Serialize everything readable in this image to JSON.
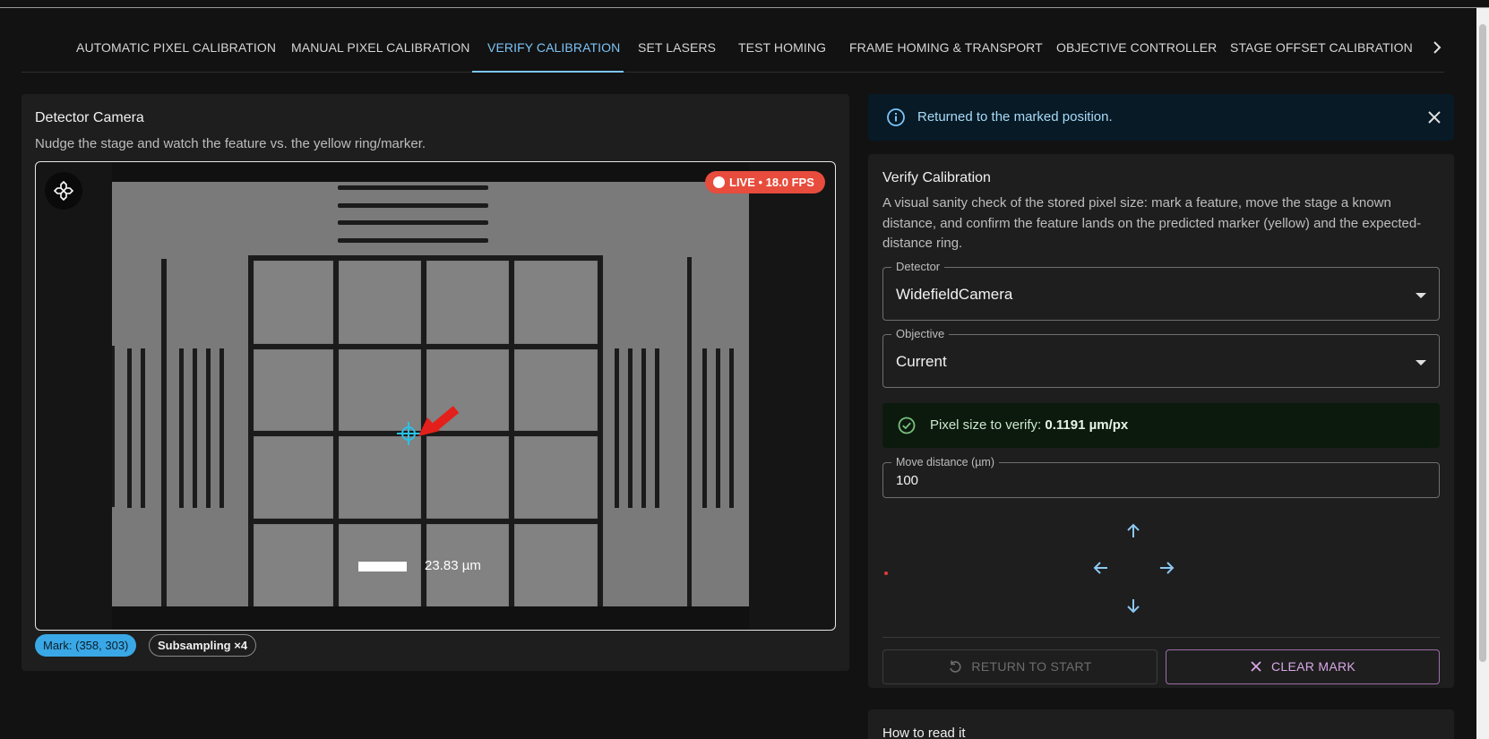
{
  "tabs": {
    "items": [
      {
        "label": "AUTOMATIC PIXEL CALIBRATION"
      },
      {
        "label": "MANUAL PIXEL CALIBRATION"
      },
      {
        "label": "VERIFY CALIBRATION"
      },
      {
        "label": "SET LASERS"
      },
      {
        "label": "TEST HOMING"
      },
      {
        "label": "FRAME HOMING & TRANSPORT"
      },
      {
        "label": "OBJECTIVE CONTROLLER"
      },
      {
        "label": "STAGE OFFSET CALIBRATION"
      }
    ],
    "active": "VERIFY CALIBRATION",
    "scroll_icon": "chevron-right-icon"
  },
  "left_panel": {
    "title": "Detector Camera",
    "subtitle": "Nudge the stage and watch the feature vs. the yellow ring/marker.",
    "live_badge": "LIVE • 18.0 FPS",
    "scale_bar_label": "23.83 µm",
    "mark_chip": "Mark: (358, 303)",
    "subsampling_chip": "Subsampling ×4",
    "gamepad_icon": "gamepad-icon"
  },
  "alert": {
    "message": "Returned to the marked position.",
    "icon": "info-icon"
  },
  "verify": {
    "title": "Verify Calibration",
    "description": "A visual sanity check of the stored pixel size: mark a feature, move the stage a known distance, and confirm the feature lands on the predicted marker (yellow) and the expected-distance ring.",
    "detector_label": "Detector",
    "detector_value": "WidefieldCamera",
    "objective_label": "Objective",
    "objective_value": "Current",
    "pixel_size_prefix": "Pixel size to verify: ",
    "pixel_size_value": "0.1191 µm/px",
    "move_label": "Move distance (µm)",
    "move_value": "100",
    "return_button": "RETURN TO START",
    "clear_button": "CLEAR MARK"
  },
  "howto": {
    "title": "How to read it"
  },
  "colors": {
    "accent": "#7cc4f8",
    "live": "#e74c3c",
    "success_bg": "#0c1a0e",
    "clear_button": "#d8a8e6"
  }
}
